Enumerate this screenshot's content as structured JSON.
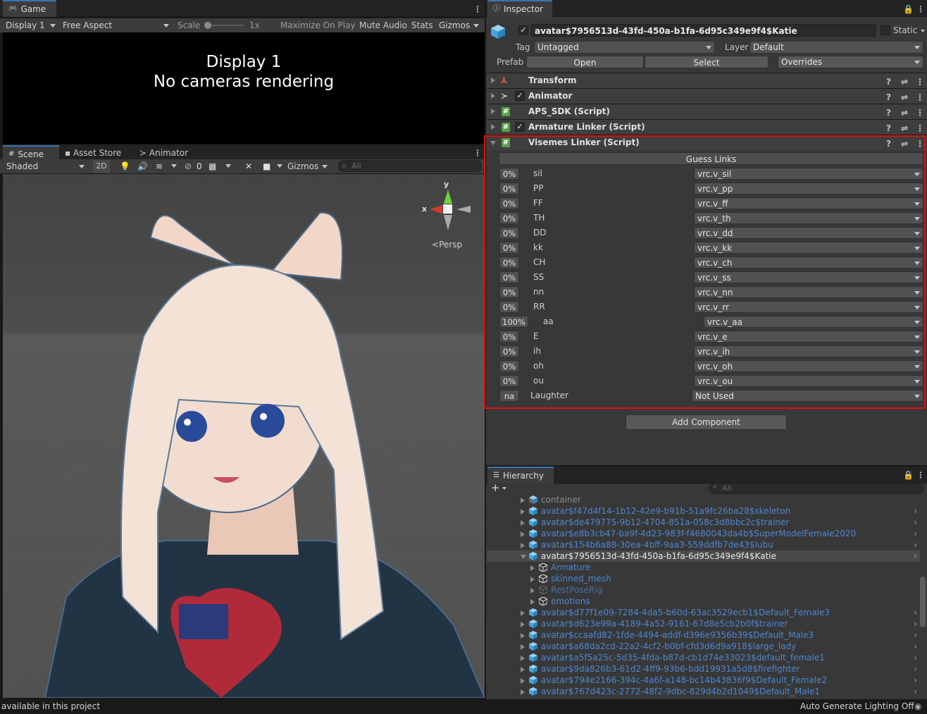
{
  "game": {
    "tab_label": "Game",
    "display_dropdown": "Display 1",
    "aspect_dropdown": "Free Aspect",
    "scale_label": "Scale",
    "scale_value": "1x",
    "maximize_label": "Maximize On Play",
    "mute_label": "Mute Audio",
    "stats_label": "Stats",
    "gizmos_label": "Gizmos",
    "message_line1": "Display 1",
    "message_line2": "No cameras rendering"
  },
  "scene": {
    "tabs": [
      "Scene",
      "Asset Store",
      "Animator"
    ],
    "shading_dropdown": "Shaded",
    "mode_2d": "2D",
    "hidden_count": "0",
    "gizmos_label": "Gizmos",
    "search_placeholder": "All",
    "gizmo_y": "y",
    "gizmo_x": "x",
    "persp_label": "Persp"
  },
  "inspector": {
    "tab_label": "Inspector",
    "object_name": "avatar$7956513d-43fd-450a-b1fa-6d95c349e9f4$Katie",
    "static_label": "Static",
    "tag_label": "Tag",
    "tag_value": "Untagged",
    "layer_label": "Layer",
    "layer_value": "Default",
    "prefab_label": "Prefab",
    "open_label": "Open",
    "select_label": "Select",
    "overrides_label": "Overrides",
    "components": [
      "Transform",
      "Animator",
      "APS_SDK (Script)",
      "Armature Linker (Script)",
      "Visemes Linker (Script)"
    ],
    "guess_links_label": "Guess Links",
    "visemes": [
      {
        "pct": "0%",
        "name": "sil",
        "link": "vrc.v_sil"
      },
      {
        "pct": "0%",
        "name": "PP",
        "link": "vrc.v_pp"
      },
      {
        "pct": "0%",
        "name": "FF",
        "link": "vrc.v_ff"
      },
      {
        "pct": "0%",
        "name": "TH",
        "link": "vrc.v_th"
      },
      {
        "pct": "0%",
        "name": "DD",
        "link": "vrc.v_dd"
      },
      {
        "pct": "0%",
        "name": "kk",
        "link": "vrc.v_kk"
      },
      {
        "pct": "0%",
        "name": "CH",
        "link": "vrc.v_ch"
      },
      {
        "pct": "0%",
        "name": "SS",
        "link": "vrc.v_ss"
      },
      {
        "pct": "0%",
        "name": "nn",
        "link": "vrc.v_nn"
      },
      {
        "pct": "0%",
        "name": "RR",
        "link": "vrc.v_rr"
      },
      {
        "pct": "100%",
        "name": "aa",
        "link": "vrc.v_aa"
      },
      {
        "pct": "0%",
        "name": "E",
        "link": "vrc.v_e"
      },
      {
        "pct": "0%",
        "name": "ih",
        "link": "vrc.v_ih"
      },
      {
        "pct": "0%",
        "name": "oh",
        "link": "vrc.v_oh"
      },
      {
        "pct": "0%",
        "name": "ou",
        "link": "vrc.v_ou"
      },
      {
        "pct": "na",
        "name": "Laughter",
        "link": "Not Used"
      }
    ],
    "add_component_label": "Add Component"
  },
  "hierarchy": {
    "tab_label": "Hierarchy",
    "search_placeholder": "All",
    "items": [
      "container",
      "avatar$f47d4f14-1b12-42e9-b91b-51a9fc26ba28$skeleton",
      "avatar$de479775-9b12-4704-851a-058c3d8bbc2c$trainer",
      "avatar$e8b3cb47-ba9f-4d23-983f-f4680043da4b$SuperModelFemale2020",
      "avatar$154b6a88-30ea-4bff-9aa3-559ddfb7de43$lubu",
      "avatar$7956513d-43fd-450a-b1fa-6d95c349e9f4$Katie",
      "Armature",
      "skinned_mesh",
      "RestPoseRig",
      "emotions",
      "avatar$d77f1e09-7284-4da5-b60d-63ac3529ecb1$Default_Female3",
      "avatar$d623e99a-4189-4a52-9161-67d8e5cb2b0f$trainer",
      "avatar$ccaafd82-1fde-4494-addf-d396e9356b39$Default_Male3",
      "avatar$a68da2cd-22a2-4cf2-b0bf-cfd3d6d9a918$large_lady",
      "avatar$a5f5a25c-5d35-4fda-b87d-cb1d74e33023$default_female1",
      "avatar$9da826b3-61d2-4ff9-93b6-bdd19931a5d8$firefighter",
      "avatar$794e2166-394c-4a6f-a148-bc14b43836f9$Default_Female2",
      "avatar$767d423c-2772-48f2-9dbc-829d4b2d1049$Default_Male1"
    ]
  },
  "status": {
    "left_text": "available in this project",
    "right_text": "Auto Generate Lighting Off"
  },
  "colors": {
    "accent": "#3a72b0",
    "highlight_border": "#e01010",
    "hierarchy_link": "#4d86d1"
  }
}
